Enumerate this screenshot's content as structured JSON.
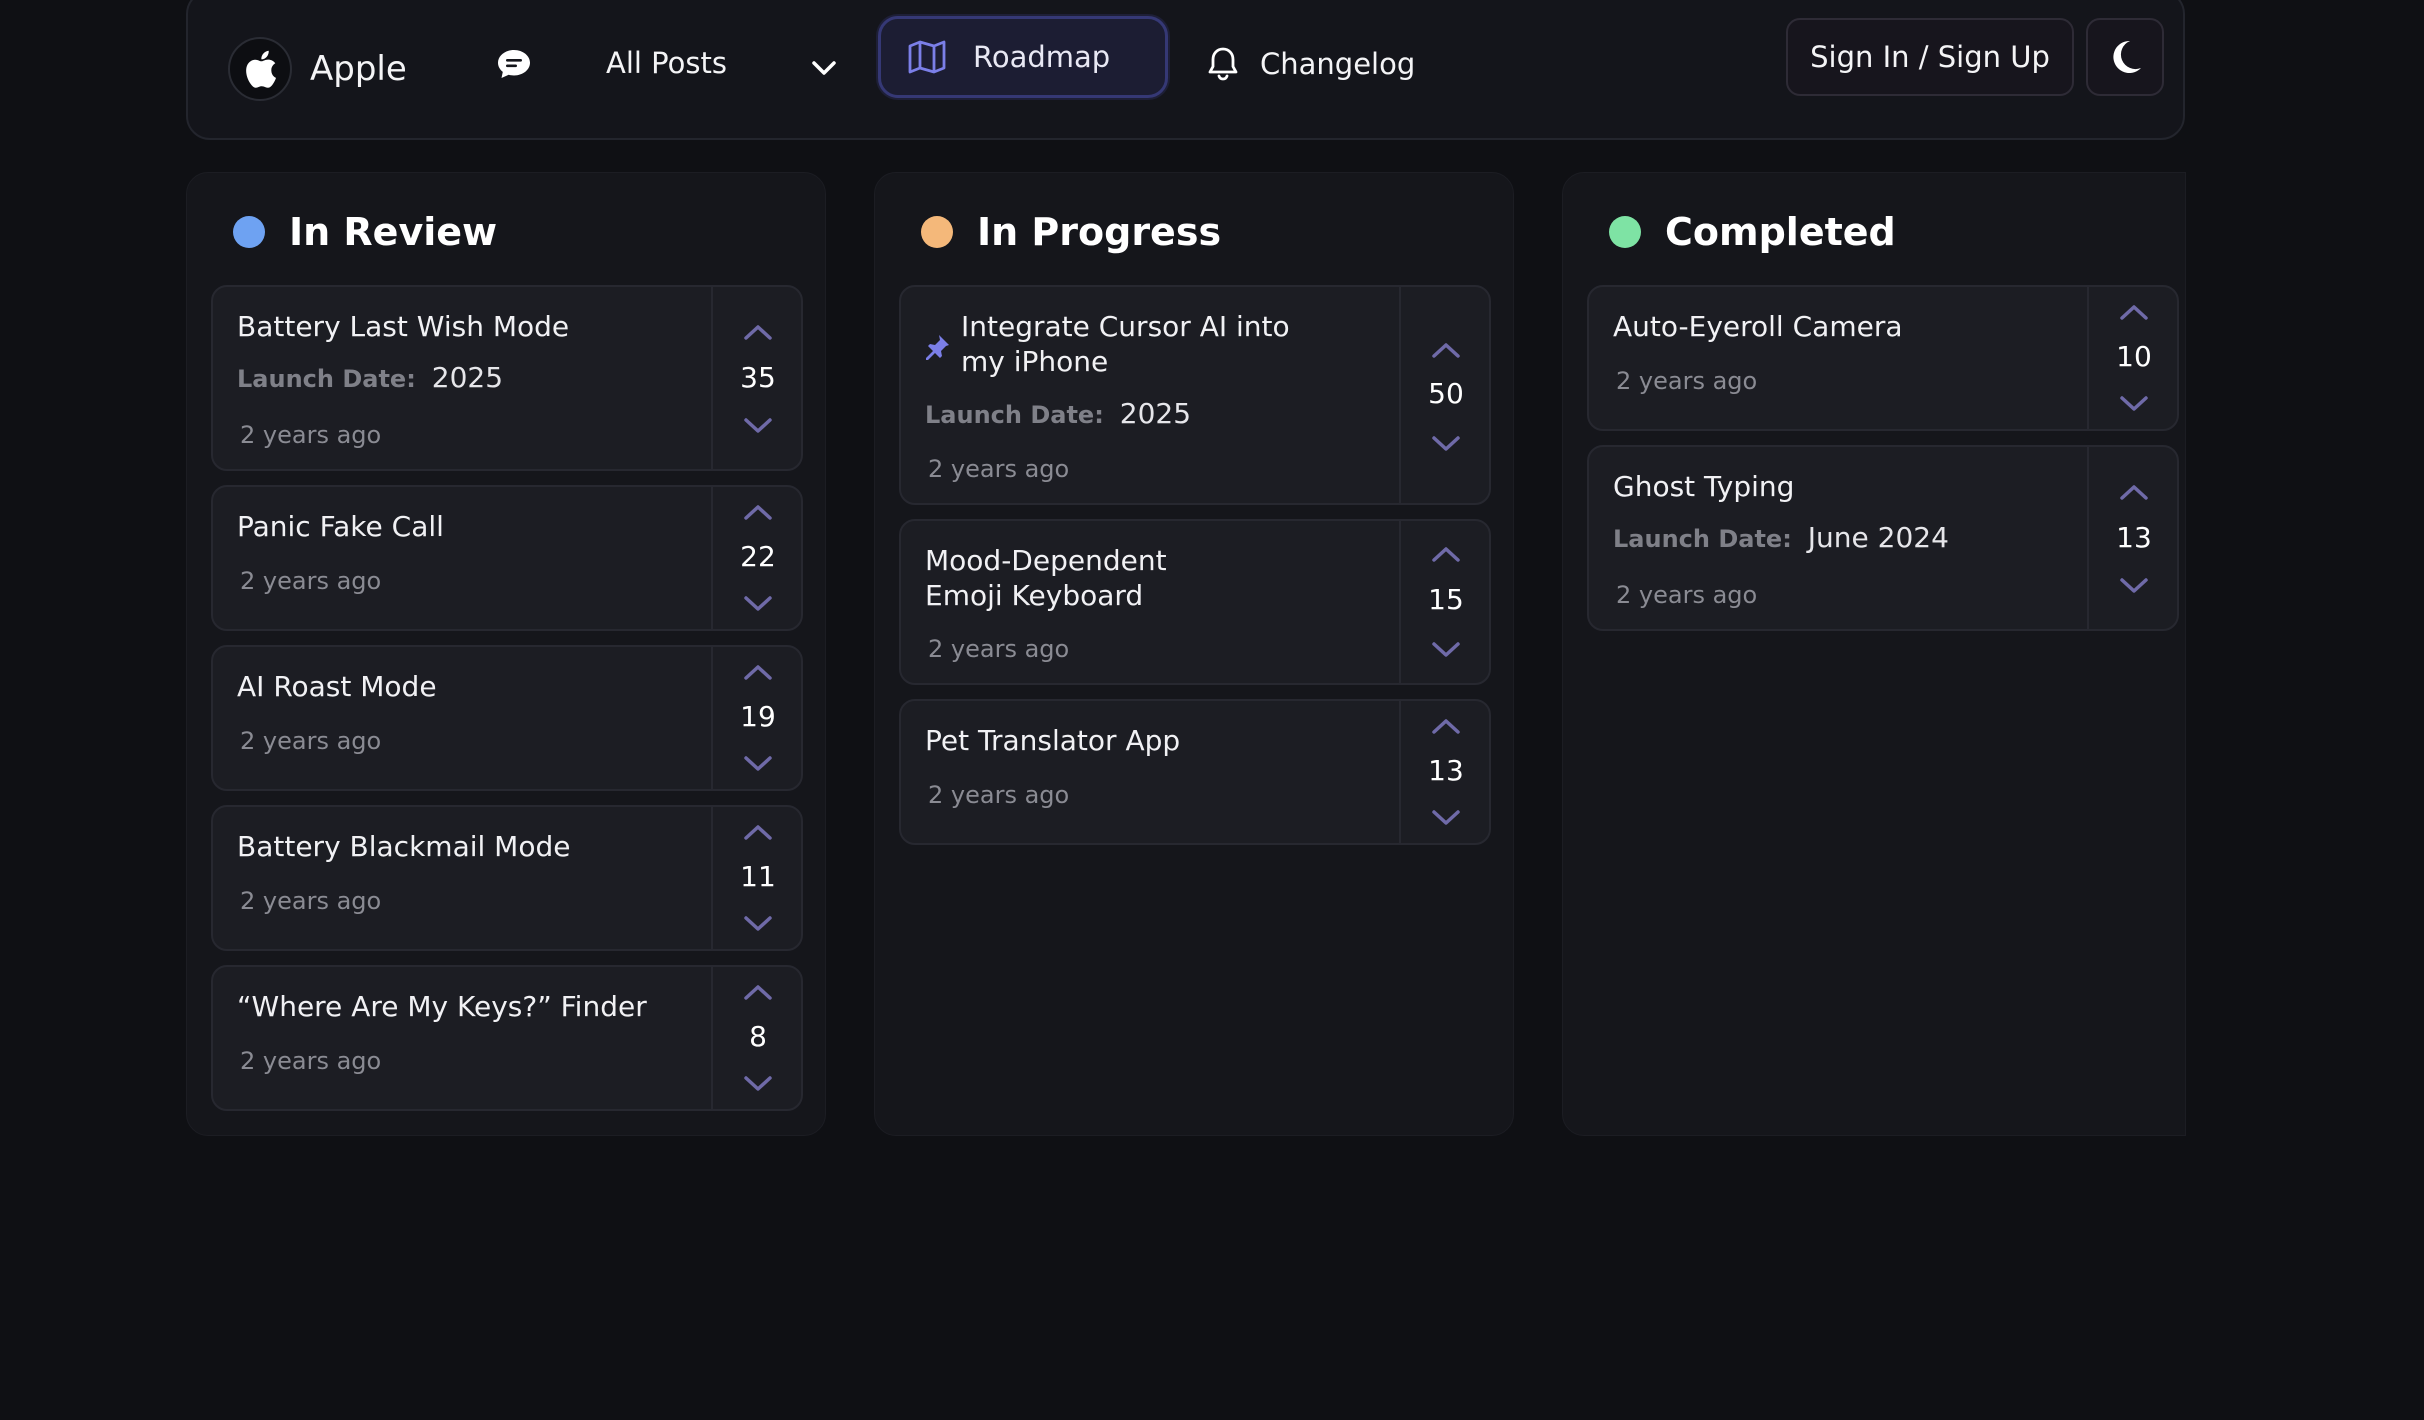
{
  "nav": {
    "brand": "Apple",
    "posts_label": "All Posts",
    "roadmap_label": "Roadmap",
    "changelog_label": "Changelog",
    "signin_label": "Sign In / Sign Up",
    "icons": [
      "apple-icon",
      "chat-bubble-icon",
      "chevron-down-icon",
      "map-icon",
      "bell-icon",
      "moon-icon"
    ]
  },
  "colors": {
    "in_review": "#6ea2f2",
    "in_progress": "#f4b87a",
    "completed": "#7ee3a4",
    "vote_arrow": "#6f6aa8",
    "accent": "#7b7fe8"
  },
  "columns": [
    {
      "title": "In Review",
      "cards": [
        {
          "title": "Battery Last Wish Mode",
          "launch_label": "Launch Date:",
          "launch_value": "2025",
          "ago": "2 years ago",
          "votes": "35"
        },
        {
          "title": "Panic Fake Call",
          "ago": "2 years ago",
          "votes": "22"
        },
        {
          "title": "AI Roast Mode",
          "ago": "2 years ago",
          "votes": "19"
        },
        {
          "title": "Battery Blackmail Mode",
          "ago": "2 years ago",
          "votes": "11"
        },
        {
          "title": "“Where Are My Keys?” Finder",
          "ago": "2 years ago",
          "votes": "8"
        }
      ]
    },
    {
      "title": "In Progress",
      "cards": [
        {
          "title_line1": "Integrate Cursor AI into",
          "title_line2": "my iPhone",
          "pinned": true,
          "launch_label": "Launch Date:",
          "launch_value": "2025",
          "ago": "2 years ago",
          "votes": "50"
        },
        {
          "title_line1": "Mood-Dependent",
          "title_line2": "Emoji Keyboard",
          "ago": "2 years ago",
          "votes": "15"
        },
        {
          "title": "Pet Translator App",
          "ago": "2 years ago",
          "votes": "13"
        }
      ]
    },
    {
      "title": "Completed",
      "cards": [
        {
          "title": "Auto-Eyeroll Camera",
          "ago": "2 years ago",
          "votes": "10"
        },
        {
          "title": "Ghost Typing",
          "launch_label": "Launch Date:",
          "launch_value": "June 2024",
          "ago": "2 years ago",
          "votes": "13"
        }
      ]
    }
  ]
}
